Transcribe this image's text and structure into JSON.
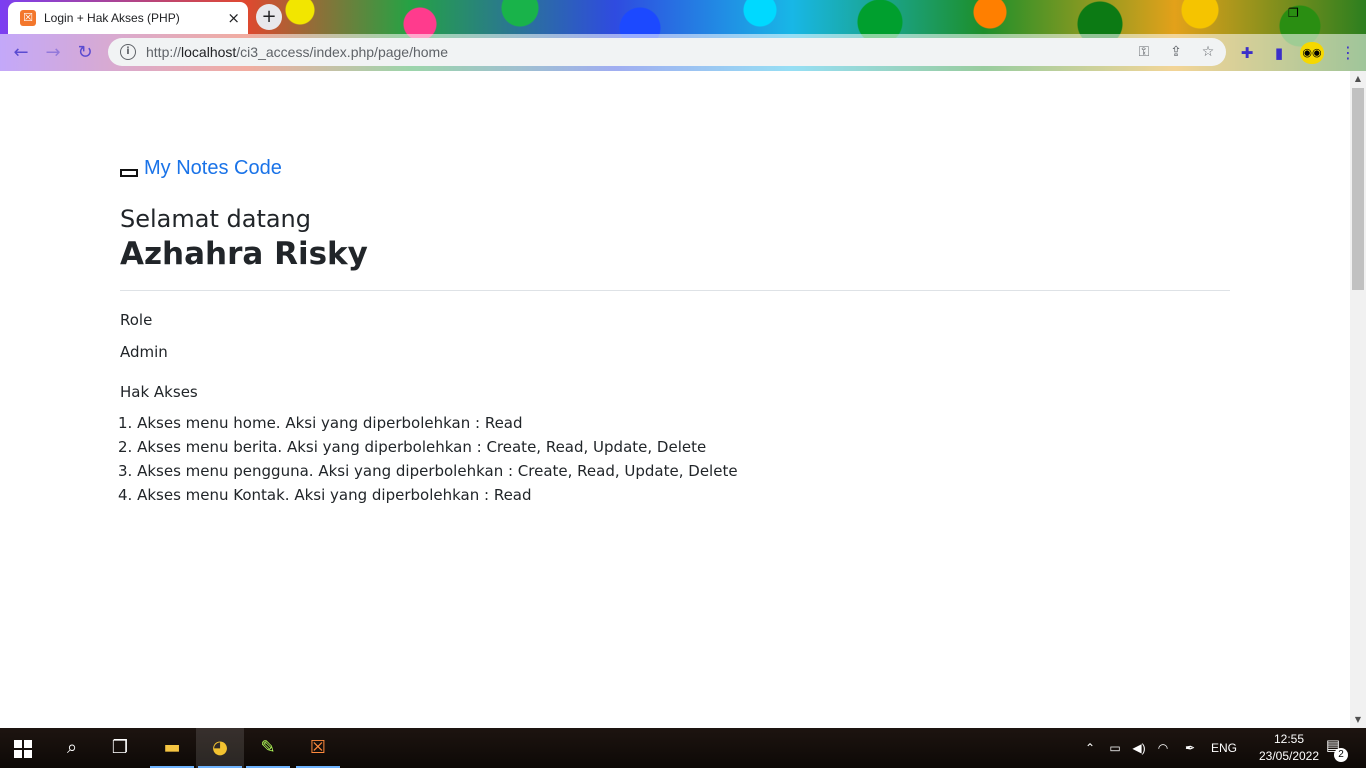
{
  "browser": {
    "tab_title": "Login + Hak Akses (PHP)",
    "tab_close": "×",
    "new_tab": "+",
    "url_prefix": "http://",
    "url_host": "localhost",
    "url_path": "/ci3_access/index.php/page/home"
  },
  "page": {
    "brand": "My Notes Code",
    "welcome": "Selamat datang",
    "username": "Azhahra Risky",
    "role_label": "Role",
    "role_value": "Admin",
    "access_label": "Hak Akses",
    "permissions": [
      "1. Akses menu home. Aksi yang diperbolehkan : Read",
      "2. Akses menu berita. Aksi yang diperbolehkan : Create, Read, Update, Delete",
      "3. Akses menu pengguna. Aksi yang diperbolehkan : Create, Read, Update, Delete",
      "4. Akses menu Kontak. Aksi yang diperbolehkan : Read"
    ]
  },
  "taskbar": {
    "language": "ENG",
    "time": "12:55",
    "date": "23/05/2022",
    "notification_count": "2"
  },
  "colors": {
    "link": "#1a73e8",
    "text": "#212529",
    "browser_accent": "#5a4bd1"
  }
}
